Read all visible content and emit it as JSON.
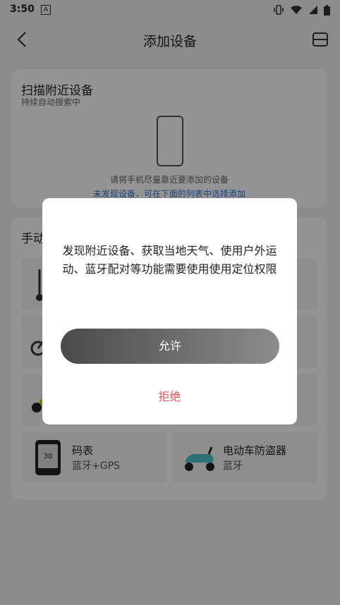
{
  "status_bar": {
    "time": "3:50",
    "app_icon_letter": "A"
  },
  "app_bar": {
    "title": "添加设备"
  },
  "scan_section": {
    "title": "扫描附近设备",
    "subtitle": "持续自动搜索中",
    "hint": "请将手机尽量靠近要添加的设备",
    "link": "未发现设备，可在下面的列表中选择添加"
  },
  "manual_section": {
    "title": "手动",
    "tiles": [
      {
        "name": "码表",
        "desc": "蓝牙+GPS"
      },
      {
        "name": "电动车防盗器",
        "desc": "蓝牙"
      }
    ]
  },
  "dialog": {
    "message": "发现附近设备、获取当地天气、使用户外运动、蓝牙配对等功能需要使用使用定位权限",
    "allow_label": "允许",
    "deny_label": "拒绝"
  },
  "colors": {
    "link": "#2f6fd0",
    "deny": "#e15555"
  }
}
